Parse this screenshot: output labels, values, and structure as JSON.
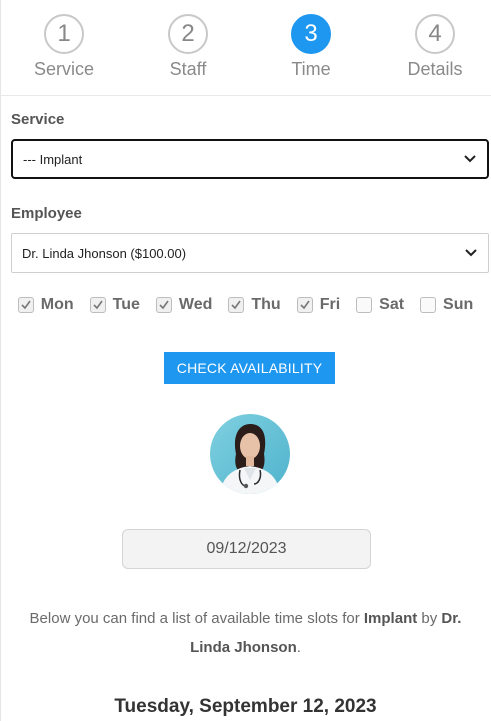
{
  "steps": [
    {
      "number": "1",
      "label": "Service"
    },
    {
      "number": "2",
      "label": "Staff"
    },
    {
      "number": "3",
      "label": "Time"
    },
    {
      "number": "4",
      "label": "Details"
    }
  ],
  "active_step": 3,
  "service": {
    "label": "Service",
    "value": "--- Implant"
  },
  "employee": {
    "label": "Employee",
    "value": "Dr. Linda Jhonson ($100.00)"
  },
  "days": [
    {
      "name": "Mon",
      "checked": true
    },
    {
      "name": "Tue",
      "checked": true
    },
    {
      "name": "Wed",
      "checked": true
    },
    {
      "name": "Thu",
      "checked": true
    },
    {
      "name": "Fri",
      "checked": true
    },
    {
      "name": "Sat",
      "checked": false
    },
    {
      "name": "Sun",
      "checked": false
    }
  ],
  "check_button": "CHECK AVAILABILITY",
  "date_value": "09/12/2023",
  "info": {
    "prefix": "Below you can find a list of available time slots for ",
    "service": "Implant",
    "middle": " by ",
    "employee": "Dr. Linda Jhonson",
    "suffix": "."
  },
  "day_heading": "Tuesday, September 12, 2023",
  "colors": {
    "accent": "#1e97f0",
    "text": "#555555"
  }
}
